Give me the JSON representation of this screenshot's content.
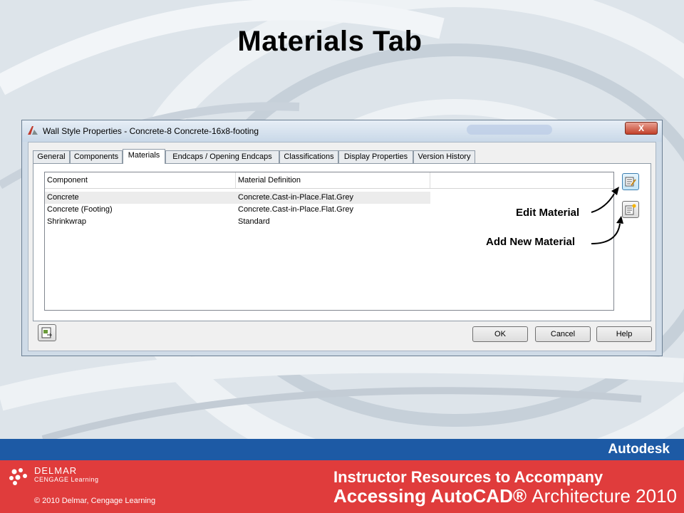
{
  "slide": {
    "title": "Materials Tab"
  },
  "dialog": {
    "title": "Wall Style Properties - Concrete-8 Concrete-16x8-footing",
    "close_label": "X",
    "tabs": [
      "General",
      "Components",
      "Materials",
      "Endcaps / Opening Endcaps",
      "Classifications",
      "Display Properties",
      "Version History"
    ],
    "active_tab": "Materials",
    "table": {
      "headers": [
        "Component",
        "Material Definition"
      ],
      "rows": [
        {
          "component": "Concrete",
          "material": "Concrete.Cast-in-Place.Flat.Grey"
        },
        {
          "component": "Concrete (Footing)",
          "material": "Concrete.Cast-in-Place.Flat.Grey"
        },
        {
          "component": "Shrinkwrap",
          "material": "Standard"
        }
      ]
    },
    "buttons": {
      "ok": "OK",
      "cancel": "Cancel",
      "help": "Help"
    }
  },
  "callouts": {
    "edit_material": "Edit Material",
    "add_new_material": "Add New Material"
  },
  "footer": {
    "brand": "Autodesk",
    "publisher": "DELMAR",
    "publisher_sub": "CENGAGE Learning",
    "copyright": "© 2010  Delmar, Cengage Learning",
    "instructor_line": "Instructor Resources to Accompany",
    "book_bold": "Accessing AutoCAD® ",
    "book_light": "Architecture 2010"
  },
  "colors": {
    "footer_blue": "#1d5aa5",
    "footer_red": "#e03c3c",
    "dialog_frame": "#cfdbe7"
  }
}
